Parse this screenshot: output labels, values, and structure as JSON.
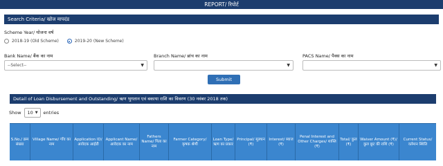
{
  "topbar": {
    "title": "REPORT/ रिपोर्ट"
  },
  "criteria": {
    "title": "Search Criteria/ खोज मापदंड",
    "scheme_label": "Scheme Year/ योजना वर्ष",
    "scheme_options": [
      "2018-19 (Old Scheme)",
      "2019-20 (New Scheme)"
    ],
    "scheme_selected": "2019-20 (New Scheme)",
    "bank_label": "Bank Name/ बैंक का नाम",
    "bank_value": "--Select--",
    "branch_label": "Branch Name/ ब्रांच का नाम",
    "branch_value": "",
    "pacs_label": "PACS Name/ पैक्स का नाम",
    "pacs_value": "",
    "submit_label": "Submit"
  },
  "details": {
    "title": "Detail of Loan Disbursement and Outstanding/ ऋण भुगतान एवं बकाया राशि का विवरण (30 नवंबर 2018 तक)",
    "show_label": "Show",
    "page_size": "10",
    "entries_label": "entries",
    "columns": [
      "S.No./ क्रम संख्या",
      "Village Name/ गाँव का नाम",
      "Application ID/ आवेदक आईडी",
      "Applicant Name/ आवेदक का नाम",
      "Fathers Name/ पिता का नाम",
      "Farmer Category/ कृषक श्रेणी",
      "Loan Type/ ऋण का प्रकार",
      "Principal/ मूलधन (₹)",
      "Interest/ ब्याज (₹)",
      "Penal Interest and Other Charges/ शास्ति (₹)",
      "Total/ कुल (₹)",
      "Waiver Amount (₹)/ कुल छूट की राशि (₹)",
      "Current Status/ वर्तमान स्थिति"
    ]
  }
}
